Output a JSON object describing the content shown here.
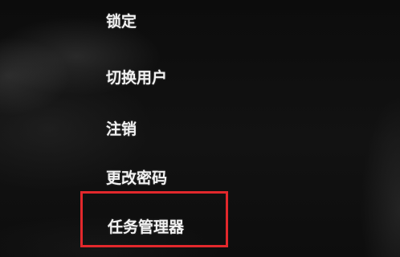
{
  "menu": {
    "items": [
      {
        "id": "lock",
        "label": "锁定"
      },
      {
        "id": "switch_user",
        "label": "切换用户"
      },
      {
        "id": "sign_out",
        "label": "注销"
      },
      {
        "id": "change_password",
        "label": "更改密码"
      },
      {
        "id": "task_manager",
        "label": "任务管理器"
      }
    ]
  },
  "annotation": {
    "highlight_color": "#e2282c",
    "highlighted_item": "task_manager"
  },
  "colors": {
    "background": "#101010",
    "text": "#f2f2f2"
  }
}
